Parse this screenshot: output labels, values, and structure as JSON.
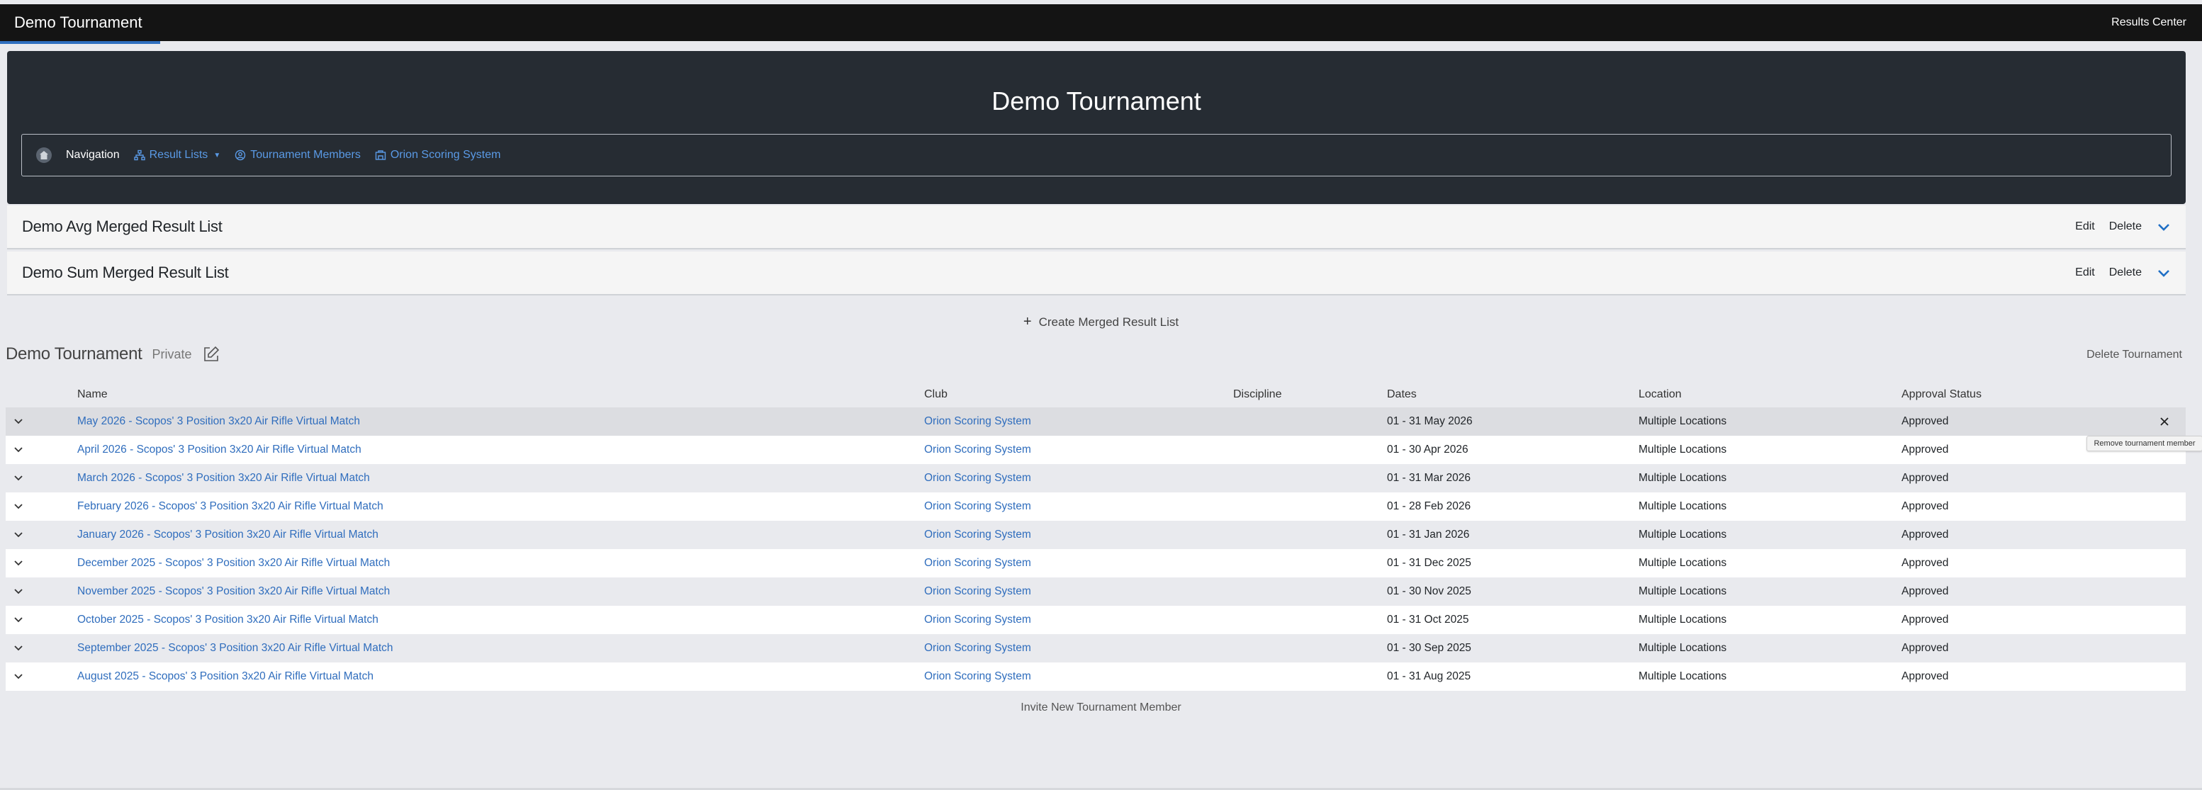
{
  "topbar": {
    "brand": "Demo Tournament",
    "right_link": "Results Center"
  },
  "hero": {
    "title": "Demo Tournament",
    "nav": {
      "label": "Navigation",
      "result_lists": "Result Lists",
      "members": "Tournament Members",
      "scoring": "Orion Scoring System"
    }
  },
  "merged_lists": [
    {
      "title": "Demo Avg Merged Result List",
      "edit": "Edit",
      "delete": "Delete"
    },
    {
      "title": "Demo Sum Merged Result List",
      "edit": "Edit",
      "delete": "Delete"
    }
  ],
  "create_merged": "Create Merged Result List",
  "tournament": {
    "title": "Demo Tournament",
    "visibility": "Private",
    "delete": "Delete Tournament"
  },
  "table": {
    "columns": {
      "name": "Name",
      "club": "Club",
      "discipline": "Discipline",
      "dates": "Dates",
      "location": "Location",
      "approval": "Approval Status"
    },
    "rows": [
      {
        "name": "May 2026 - Scopos' 3 Position 3x20 Air Rifle Virtual Match",
        "club": "Orion Scoring System",
        "discipline": "",
        "dates": "01 - 31 May 2026",
        "location": "Multiple Locations",
        "approval": "Approved"
      },
      {
        "name": "April 2026 - Scopos' 3 Position 3x20 Air Rifle Virtual Match",
        "club": "Orion Scoring System",
        "discipline": "",
        "dates": "01 - 30 Apr 2026",
        "location": "Multiple Locations",
        "approval": "Approved"
      },
      {
        "name": "March 2026 - Scopos' 3 Position 3x20 Air Rifle Virtual Match",
        "club": "Orion Scoring System",
        "discipline": "",
        "dates": "01 - 31 Mar 2026",
        "location": "Multiple Locations",
        "approval": "Approved"
      },
      {
        "name": "February 2026 - Scopos' 3 Position 3x20 Air Rifle Virtual Match",
        "club": "Orion Scoring System",
        "discipline": "",
        "dates": "01 - 28 Feb 2026",
        "location": "Multiple Locations",
        "approval": "Approved"
      },
      {
        "name": "January 2026 - Scopos' 3 Position 3x20 Air Rifle Virtual Match",
        "club": "Orion Scoring System",
        "discipline": "",
        "dates": "01 - 31 Jan 2026",
        "location": "Multiple Locations",
        "approval": "Approved"
      },
      {
        "name": "December 2025 - Scopos' 3 Position 3x20 Air Rifle Virtual Match",
        "club": "Orion Scoring System",
        "discipline": "",
        "dates": "01 - 31 Dec 2025",
        "location": "Multiple Locations",
        "approval": "Approved"
      },
      {
        "name": "November 2025 - Scopos' 3 Position 3x20 Air Rifle Virtual Match",
        "club": "Orion Scoring System",
        "discipline": "",
        "dates": "01 - 30 Nov 2025",
        "location": "Multiple Locations",
        "approval": "Approved"
      },
      {
        "name": "October 2025 - Scopos' 3 Position 3x20 Air Rifle Virtual Match",
        "club": "Orion Scoring System",
        "discipline": "",
        "dates": "01 - 31 Oct 2025",
        "location": "Multiple Locations",
        "approval": "Approved"
      },
      {
        "name": "September 2025 - Scopos' 3 Position 3x20 Air Rifle Virtual Match",
        "club": "Orion Scoring System",
        "discipline": "",
        "dates": "01 - 30 Sep 2025",
        "location": "Multiple Locations",
        "approval": "Approved"
      },
      {
        "name": "August 2025 - Scopos' 3 Position 3x20 Air Rifle Virtual Match",
        "club": "Orion Scoring System",
        "discipline": "",
        "dates": "01 - 31 Aug 2025",
        "location": "Multiple Locations",
        "approval": "Approved"
      }
    ]
  },
  "tooltip": "Remove tournament member",
  "invite": "Invite New Tournament Member",
  "colors": {
    "link": "#2f6dbd",
    "nav_link": "#5a9ae6",
    "hero_bg": "#262c33",
    "topbar_bg": "#141414",
    "accent": "#2f6fbf"
  },
  "icons": [
    "home-icon",
    "sitemap-icon",
    "user-circle-icon",
    "building-icon",
    "edit-icon",
    "chevron-down-icon",
    "close-icon",
    "plus-icon"
  ]
}
